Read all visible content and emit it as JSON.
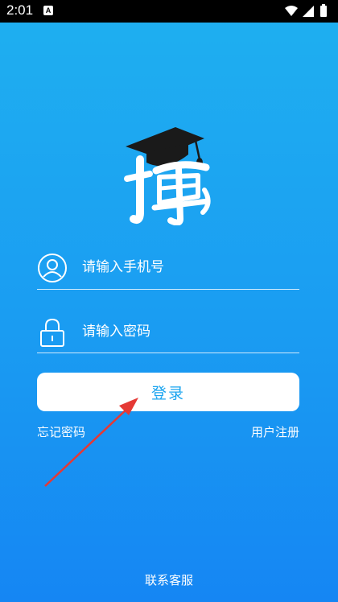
{
  "status_bar": {
    "time": "2:01",
    "notification_icon": "A"
  },
  "login": {
    "phone_placeholder": "请输入手机号",
    "password_placeholder": "请输入密码",
    "login_button": "登录",
    "forgot_password": "忘记密码",
    "register": "用户注册",
    "contact_service": "联系客服"
  },
  "icons": [
    "user-icon",
    "lock-icon",
    "graduation-cap-icon",
    "wifi-icon",
    "signal-icon",
    "battery-icon"
  ],
  "colors": {
    "background_top": "#1fb0f0",
    "background_bottom": "#1586f3",
    "button_text": "#1aa4ef",
    "annotation_arrow": "#e53935"
  }
}
